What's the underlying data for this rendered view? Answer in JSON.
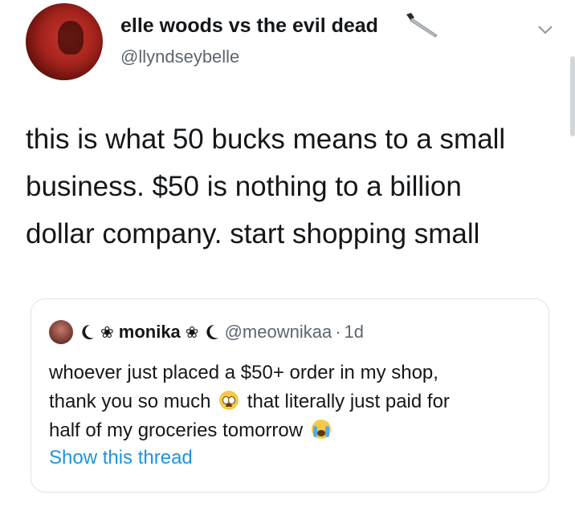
{
  "tweet": {
    "display_name": "elle woods vs the evil dead",
    "handle": "@llyndseybelle",
    "text_lines": [
      "this is what 50 bucks means to a small",
      "business. $50 is nothing to a billion",
      "dollar company. start shopping small"
    ],
    "icons": {
      "name_suffix": "knife-icon",
      "menu": "chevron-down-icon"
    }
  },
  "quote": {
    "name": "monika",
    "flower": "❀",
    "handle": "@meownikaa",
    "separator": "·",
    "time": "1d",
    "lines": [
      "whoever just placed a $50+ order in my shop,",
      "thank you so much",
      "that literally just paid for",
      "half of my groceries tomorrow"
    ],
    "show_thread": "Show this thread",
    "link_color": "#1b95e0"
  }
}
